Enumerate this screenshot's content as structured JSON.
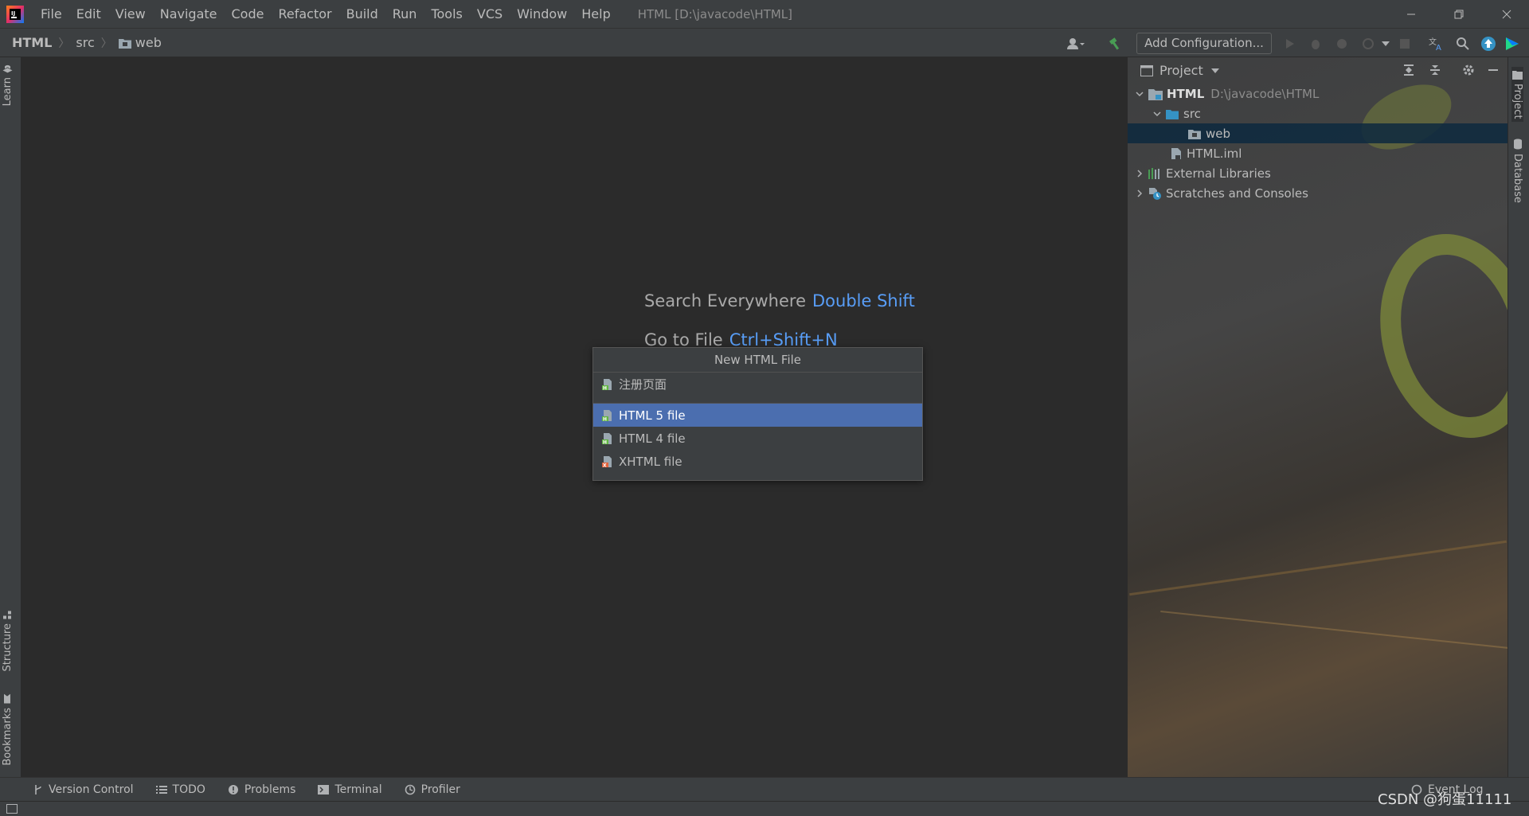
{
  "app": {
    "window_title": "HTML [D:\\javacode\\HTML]",
    "menu": [
      "File",
      "Edit",
      "View",
      "Navigate",
      "Code",
      "Refactor",
      "Build",
      "Run",
      "Tools",
      "VCS",
      "Window",
      "Help"
    ]
  },
  "breadcrumb": [
    "HTML",
    "src",
    "web"
  ],
  "toolbar": {
    "add_configuration": "Add Configuration..."
  },
  "left_tools": {
    "learn": "Learn",
    "structure": "Structure",
    "bookmarks": "Bookmarks"
  },
  "editor": {
    "hints": [
      {
        "label": "Search Everywhere",
        "key": "Double Shift"
      },
      {
        "label": "Go to File",
        "key": "Ctrl+Shift+N"
      }
    ]
  },
  "popup": {
    "title": "New HTML File",
    "recent": [
      "注册页面"
    ],
    "items": [
      {
        "label": "HTML 5 file",
        "selected": true
      },
      {
        "label": "HTML 4 file",
        "selected": false
      },
      {
        "label": "XHTML file",
        "selected": false
      }
    ]
  },
  "project": {
    "view_title": "Project",
    "tree": {
      "root": {
        "name": "HTML",
        "path": "D:\\javacode\\HTML"
      },
      "src": "src",
      "web": "web",
      "iml": "HTML.iml",
      "ext_libs": "External Libraries",
      "scratches": "Scratches and Consoles"
    }
  },
  "right_tools": {
    "project": "Project",
    "database": "Database"
  },
  "bottom_tools": [
    "Version Control",
    "TODO",
    "Problems",
    "Terminal",
    "Profiler"
  ],
  "status": {
    "event_log": "Event Log",
    "watermark": "CSDN @狗蛋11111"
  },
  "colors": {
    "accent": "#589df6",
    "selection": "#4b6eaf",
    "tree_selection": "#0d293e",
    "folder": "#3592c4",
    "build_green": "#499c54"
  }
}
